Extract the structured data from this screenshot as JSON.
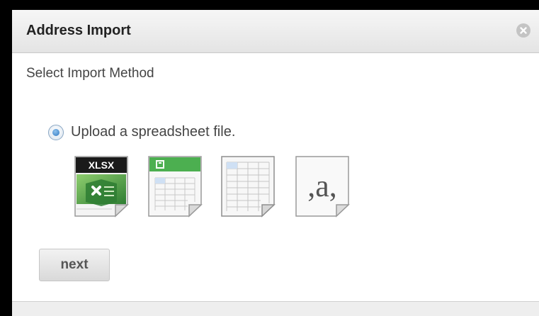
{
  "dialog": {
    "title": "Address Import",
    "close_icon": "close-icon"
  },
  "content": {
    "subtitle": "Select Import Method",
    "upload_option": {
      "label": "Upload a spreadsheet file.",
      "selected": true
    },
    "file_types": [
      {
        "icon": "xlsx-file-icon",
        "badge": "XLSX"
      },
      {
        "icon": "ods-file-icon"
      },
      {
        "icon": "spreadsheet-file-icon"
      },
      {
        "icon": "csv-file-icon",
        "glyph": ",a,"
      }
    ]
  },
  "actions": {
    "next_label": "next"
  },
  "colors": {
    "excel_green": "#2e7d32",
    "ods_green": "#4caf50",
    "radio_blue": "#2f77c0"
  }
}
